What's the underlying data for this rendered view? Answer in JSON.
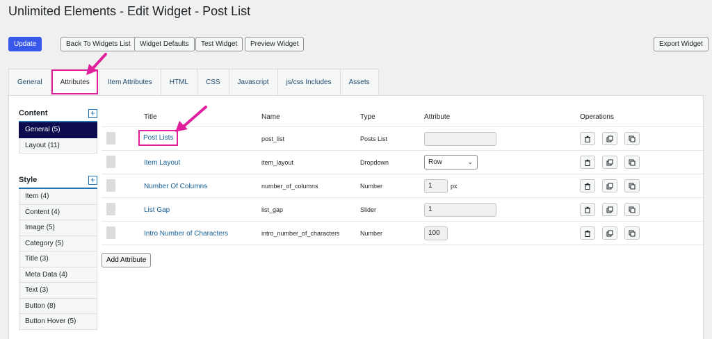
{
  "header": {
    "title": "Unlimited Elements - Edit Widget - Post List"
  },
  "toolbar": {
    "update": "Update",
    "back": "Back To Widgets List",
    "defaults": "Widget Defaults",
    "test": "Test Widget",
    "preview": "Preview Widget",
    "export": "Export Widget"
  },
  "tabs": [
    "General",
    "Attributes",
    "Item Attributes",
    "HTML",
    "CSS",
    "Javascript",
    "js/css Includes",
    "Assets"
  ],
  "sidebar": {
    "content_title": "Content",
    "content_items": [
      "General  (5)",
      "Layout (11)"
    ],
    "style_title": "Style",
    "style_items": [
      "Item (4)",
      "Content (4)",
      "Image (5)",
      "Category (5)",
      "Title (3)",
      "Meta Data (4)",
      "Text (3)",
      "Button (8)",
      "Button Hover (5)"
    ],
    "plus": "+"
  },
  "table": {
    "headers": {
      "title": "Title",
      "name": "Name",
      "type": "Type",
      "attribute": "Attribute",
      "operations": "Operations"
    },
    "rows": [
      {
        "title": "Post Lists",
        "name": "post_list",
        "type": "Posts List",
        "attribute": ""
      },
      {
        "title": "Item Layout",
        "name": "item_layout",
        "type": "Dropdown",
        "attribute": "Row"
      },
      {
        "title": "Number Of Columns",
        "name": "number_of_columns",
        "type": "Number",
        "attribute": "1",
        "unit": "px"
      },
      {
        "title": "List Gap",
        "name": "list_gap",
        "type": "Slider",
        "attribute": "1"
      },
      {
        "title": "Intro Number of Characters",
        "name": "intro_number_of_characters",
        "type": "Number",
        "attribute": "100"
      }
    ],
    "add_button": "Add Attribute"
  },
  "colors": {
    "accent": "#3858e9",
    "highlight": "#e01f9c",
    "link": "#135e96",
    "active_side": "#0b0b4d"
  }
}
